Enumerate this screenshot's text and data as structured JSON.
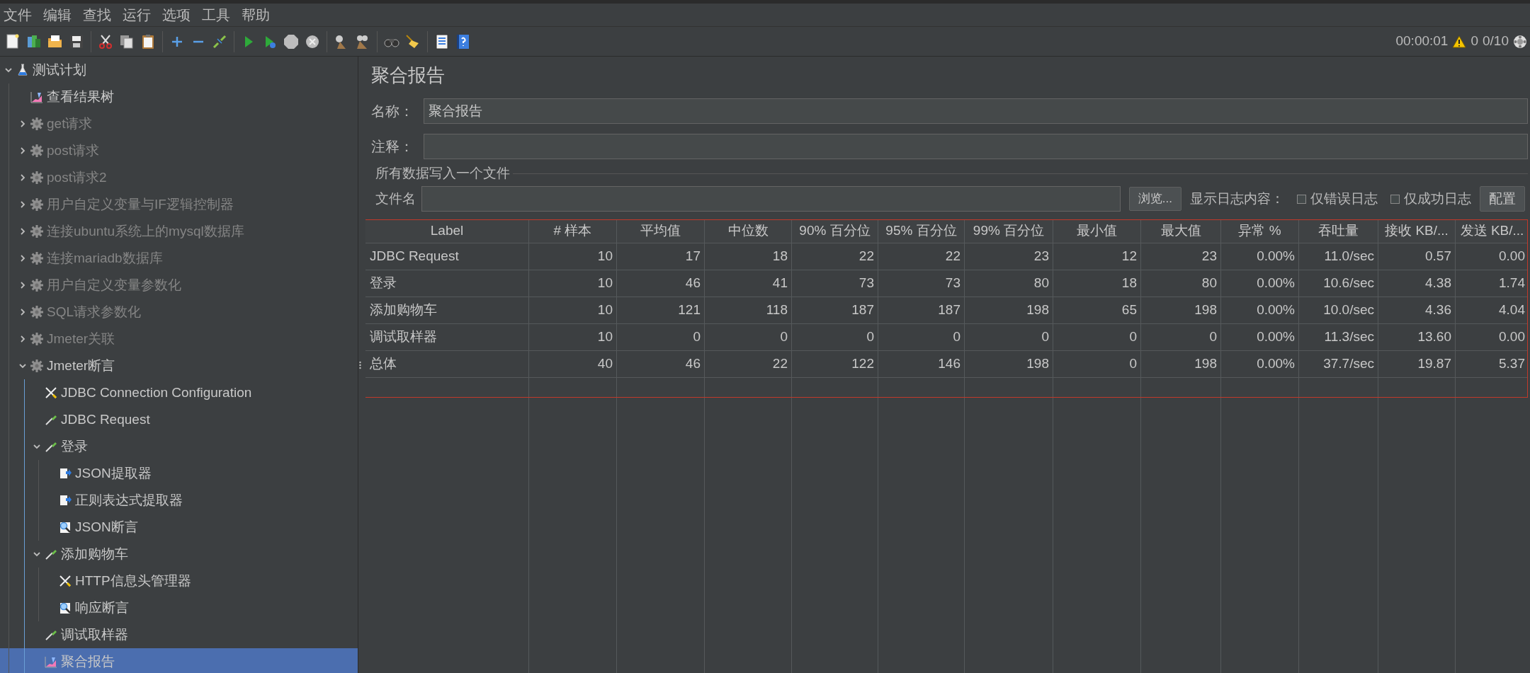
{
  "menu": [
    "文件",
    "编辑",
    "查找",
    "运行",
    "选项",
    "工具",
    "帮助"
  ],
  "status": {
    "timer": "00:00:01",
    "warnings": "0",
    "threads": "0/10"
  },
  "tree": [
    {
      "label": "测试计划",
      "kind": "testplan",
      "expandable": true,
      "expanded": true,
      "disabled": false,
      "selected": false,
      "children": [
        {
          "label": "查看结果树",
          "kind": "listener",
          "expandable": false,
          "disabled": false,
          "selected": false
        },
        {
          "label": "get请求",
          "kind": "threadgroup",
          "expandable": true,
          "expanded": false,
          "disabled": true,
          "selected": false
        },
        {
          "label": "post请求",
          "kind": "threadgroup",
          "expandable": true,
          "expanded": false,
          "disabled": true,
          "selected": false
        },
        {
          "label": "post请求2",
          "kind": "threadgroup",
          "expandable": true,
          "expanded": false,
          "disabled": true,
          "selected": false
        },
        {
          "label": "用户自定义变量与IF逻辑控制器",
          "kind": "threadgroup",
          "expandable": true,
          "expanded": false,
          "disabled": true,
          "selected": false
        },
        {
          "label": "连接ubuntu系统上的mysql数据库",
          "kind": "threadgroup",
          "expandable": true,
          "expanded": false,
          "disabled": true,
          "selected": false
        },
        {
          "label": "连接mariadb数据库",
          "kind": "threadgroup",
          "expandable": true,
          "expanded": false,
          "disabled": true,
          "selected": false
        },
        {
          "label": "用户自定义变量参数化",
          "kind": "threadgroup",
          "expandable": true,
          "expanded": false,
          "disabled": true,
          "selected": false
        },
        {
          "label": "SQL请求参数化",
          "kind": "threadgroup",
          "expandable": true,
          "expanded": false,
          "disabled": true,
          "selected": false
        },
        {
          "label": "Jmeter关联",
          "kind": "threadgroup",
          "expandable": true,
          "expanded": false,
          "disabled": true,
          "selected": false
        },
        {
          "label": "Jmeter断言",
          "kind": "threadgroup",
          "expandable": true,
          "expanded": true,
          "disabled": false,
          "selected": false,
          "children": [
            {
              "label": "JDBC Connection Configuration",
              "kind": "config",
              "expandable": false,
              "disabled": false,
              "selected": false
            },
            {
              "label": "JDBC Request",
              "kind": "sampler",
              "expandable": false,
              "disabled": false,
              "selected": false
            },
            {
              "label": "登录",
              "kind": "sampler",
              "expandable": true,
              "expanded": true,
              "disabled": false,
              "selected": false,
              "children": [
                {
                  "label": "JSON提取器",
                  "kind": "extractor",
                  "expandable": false,
                  "disabled": false,
                  "selected": false
                },
                {
                  "label": "正则表达式提取器",
                  "kind": "extractor",
                  "expandable": false,
                  "disabled": false,
                  "selected": false
                },
                {
                  "label": "JSON断言",
                  "kind": "assertion",
                  "expandable": false,
                  "disabled": false,
                  "selected": false
                }
              ]
            },
            {
              "label": "添加购物车",
              "kind": "sampler",
              "expandable": true,
              "expanded": true,
              "disabled": false,
              "selected": false,
              "children": [
                {
                  "label": "HTTP信息头管理器",
                  "kind": "config",
                  "expandable": false,
                  "disabled": false,
                  "selected": false
                },
                {
                  "label": "响应断言",
                  "kind": "assertion",
                  "expandable": false,
                  "disabled": false,
                  "selected": false
                }
              ]
            },
            {
              "label": "调试取样器",
              "kind": "sampler",
              "expandable": false,
              "disabled": false,
              "selected": false
            },
            {
              "label": "聚合报告",
              "kind": "listener",
              "expandable": false,
              "disabled": false,
              "selected": true
            }
          ]
        }
      ]
    }
  ],
  "panel": {
    "title": "聚合报告",
    "name_label": "名称：",
    "name_value": "聚合报告",
    "comment_label": "注释：",
    "group_title": "所有数据写入一个文件",
    "file_label": "文件名",
    "browse_button": "浏览...",
    "log_label": "显示日志内容：",
    "checkboxes": [
      {
        "label": "仅错误日志",
        "checked": false
      },
      {
        "label": "仅成功日志",
        "checked": false
      }
    ],
    "config_button": "配置"
  },
  "table": {
    "columns": [
      "Label",
      "# 样本",
      "平均值",
      "中位数",
      "90% 百分位",
      "95% 百分位",
      "99% 百分位",
      "最小值",
      "最大值",
      "异常 %",
      "吞吐量",
      "接收 KB/...",
      "发送 KB/..."
    ],
    "rows": [
      [
        "JDBC Request",
        "10",
        "17",
        "18",
        "22",
        "22",
        "23",
        "12",
        "23",
        "0.00%",
        "11.0/sec",
        "0.57",
        "0.00"
      ],
      [
        "登录",
        "10",
        "46",
        "41",
        "73",
        "73",
        "80",
        "18",
        "80",
        "0.00%",
        "10.6/sec",
        "4.38",
        "1.74"
      ],
      [
        "添加购物车",
        "10",
        "121",
        "118",
        "187",
        "187",
        "198",
        "65",
        "198",
        "0.00%",
        "10.0/sec",
        "4.36",
        "4.04"
      ],
      [
        "调试取样器",
        "10",
        "0",
        "0",
        "0",
        "0",
        "0",
        "0",
        "0",
        "0.00%",
        "11.3/sec",
        "13.60",
        "0.00"
      ],
      [
        "总体",
        "40",
        "46",
        "22",
        "122",
        "146",
        "198",
        "0",
        "198",
        "0.00%",
        "37.7/sec",
        "19.87",
        "5.37"
      ]
    ]
  }
}
